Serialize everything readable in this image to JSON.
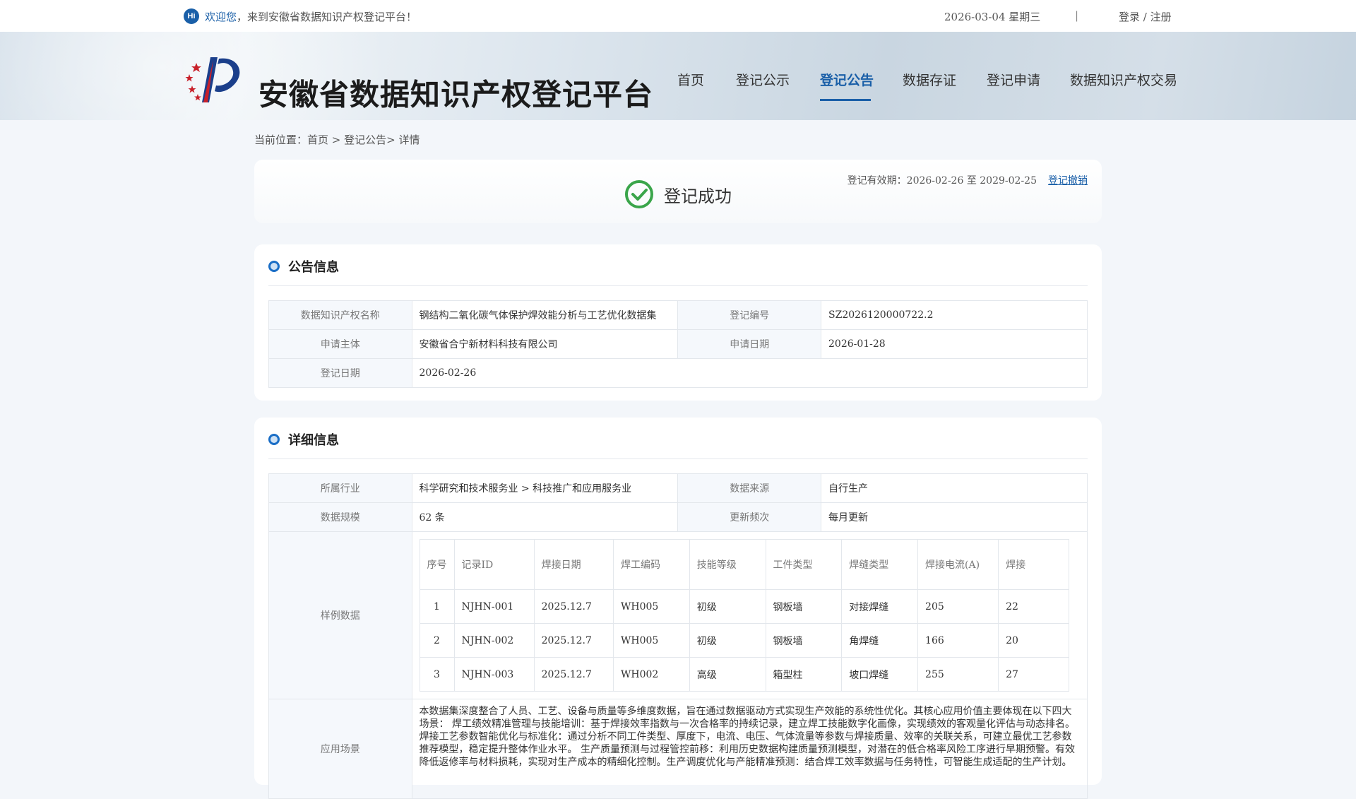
{
  "topbar": {
    "hi": "Hi",
    "welcome_highlight": "欢迎您",
    "welcome_rest": "，来到安徽省数据知识产权登记平台！",
    "date": "2026-03-04 星期三",
    "separator": "|",
    "login": "登录 / 注册"
  },
  "header": {
    "site_title": "安徽省数据知识产权登记平台",
    "nav": [
      "首页",
      "登记公示",
      "登记公告",
      "数据存证",
      "登记申请",
      "数据知识产权交易"
    ],
    "active_nav": "登记公告"
  },
  "breadcrumb": "当前位置：首页 > 登记公告> 详情",
  "status": {
    "text": "登记成功",
    "validity": "登记有效期：2026-02-26 至 2029-02-25",
    "revoke": "登记撤销",
    "success_color": "#3aa54a"
  },
  "announcement": {
    "title": "公告信息",
    "name_label": "数据知识产权名称",
    "name_value": "钢结构二氧化碳气体保护焊效能分析与工艺优化数据集",
    "reg_no_label": "登记编号",
    "reg_no_value": "SZ2026120000722.2",
    "applicant_label": "申请主体",
    "applicant_value": "安徽省合宁新材料科技有限公司",
    "apply_date_label": "申请日期",
    "apply_date_value": "2026-01-28",
    "reg_date_label": "登记日期",
    "reg_date_value": "2026-02-26"
  },
  "detail": {
    "title": "详细信息",
    "industry_label": "所属行业",
    "industry_value": "科学研究和技术服务业 > 科技推广和应用服务业",
    "source_label": "数据来源",
    "source_value": "自行生产",
    "scale_label": "数据规模",
    "scale_value": "62 条",
    "freq_label": "更新频次",
    "freq_value": "每月更新",
    "sample_label": "样例数据",
    "sample_headers": [
      "序号",
      "记录ID",
      "焊接日期",
      "焊工编码",
      "技能等级",
      "工件类型",
      "焊缝类型",
      "焊接电流(A)",
      "焊接"
    ],
    "sample_rows": [
      [
        "1",
        "NJHN-001",
        "2025.12.7",
        "WH005",
        "初级",
        "钢板墙",
        "对接焊缝",
        "205",
        "22"
      ],
      [
        "2",
        "NJHN-002",
        "2025.12.7",
        "WH005",
        "初级",
        "钢板墙",
        "角焊缝",
        "166",
        "20"
      ],
      [
        "3",
        "NJHN-003",
        "2025.12.7",
        "WH002",
        "高级",
        "箱型柱",
        "坡口焊缝",
        "255",
        "27"
      ]
    ],
    "usage_label": "应用场景",
    "usage_text": "本数据集深度整合了人员、工艺、设备与质量等多维度数据，旨在通过数据驱动方式实现生产效能的系统性优化。其核心应用价值主要体现在以下四大场景： 焊工绩效精准管理与技能培训：基于焊接效率指数与一次合格率的持续记录，建立焊工技能数字化画像，实现绩效的客观量化评估与动态排名。 焊接工艺参数智能优化与标准化：通过分析不同工件类型、厚度下，电流、电压、气体流量等参数与焊接质量、效率的关联关系，可建立最优工艺参数推荐模型，稳定提升整体作业水平。 生产质量预测与过程管控前移：利用历史数据构建质量预测模型，对潜在的低合格率风险工序进行早期预警。有效降低返修率与材料损耗，实现对生产成本的精细化控制。生产调度优化与产能精准预测：结合焊工效率数据与任务特性，可智能生成适配的生产计划。"
  }
}
